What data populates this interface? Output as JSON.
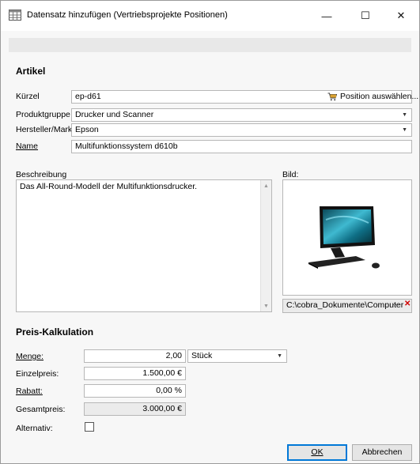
{
  "window": {
    "title": "Datensatz hinzufügen (Vertriebsprojekte Positionen)",
    "minimize": "—",
    "maximize": "☐",
    "close": "✕"
  },
  "artikel": {
    "section_title": "Artikel",
    "kuerzel_label": "Kürzel",
    "kuerzel_value": "ep-d61",
    "position_button": "Position auswählen...",
    "produktgruppe_label": "Produktgruppe",
    "produktgruppe_value": "Drucker und Scanner",
    "hersteller_label": "Hersteller/Marke",
    "hersteller_value": "Epson",
    "name_label": "Name",
    "name_value": "Multifunktionssystem d610b",
    "beschreibung_label": "Beschreibung",
    "beschreibung_value": "Das All-Round-Modell der Multifunktionsdrucker.",
    "bild_label": "Bild:",
    "bild_path": "C:\\cobra_Dokumente\\Computer",
    "bild_browse": "···",
    "bild_clear": "✕"
  },
  "preis": {
    "section_title": "Preis-Kalkulation",
    "menge_label": "Menge:",
    "menge_value": "2,00",
    "einheit_value": "Stück",
    "einzelpreis_label": "Einzelpreis:",
    "einzelpreis_value": "1.500,00 €",
    "rabatt_label": "Rabatt:",
    "rabatt_value": "0,00 %",
    "gesamtpreis_label": "Gesamtpreis:",
    "gesamtpreis_value": "3.000,00 €",
    "alternativ_label": "Alternativ:",
    "alternativ_checked": false
  },
  "buttons": {
    "ok": "OK",
    "cancel": "Abbrechen"
  },
  "colors": {
    "accent": "#0078d7",
    "clear": "#d00000"
  }
}
